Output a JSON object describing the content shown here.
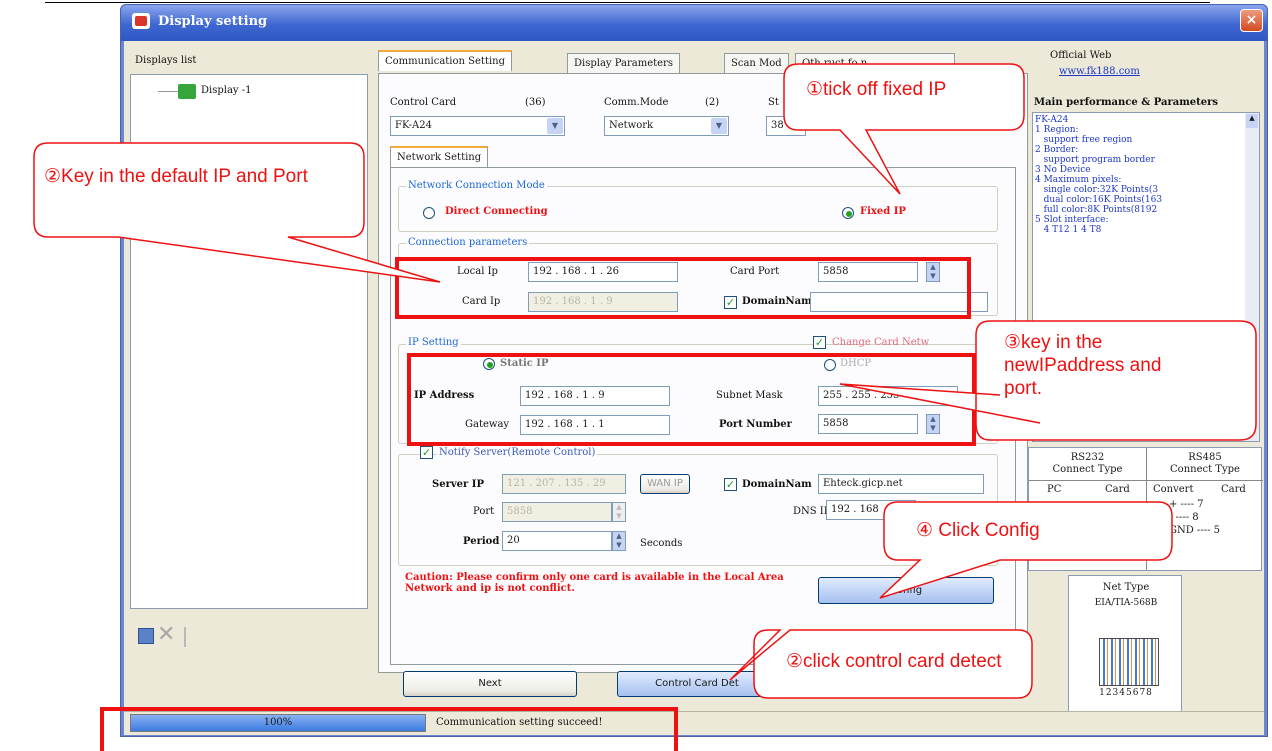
{
  "window": {
    "title": "Display setting",
    "close": "×"
  },
  "displays": {
    "heading": "Displays list",
    "item": "Display -1"
  },
  "tabs": [
    "Communication Setting",
    "Display Parameters",
    "Scan Mod",
    "Oth  ruct  fo n"
  ],
  "control": {
    "card_label": "Control Card",
    "card_count": "(36)",
    "card_value": "FK-A24",
    "comm_label": "Comm.Mode",
    "comm_count": "(2)",
    "comm_value": "Network",
    "third_label": "St",
    "third_value": "38"
  },
  "subtab": "Network Setting",
  "network_mode": {
    "legend": "Network Connection Mode",
    "direct": "Direct Connecting",
    "fixed": "Fixed IP"
  },
  "conn_params": {
    "legend": "Connection parameters",
    "local_ip_label": "Local Ip",
    "local_ip": [
      "192",
      "168",
      "1",
      "26"
    ],
    "card_ip_label": "Card Ip",
    "card_ip": [
      "192",
      "168",
      "1",
      "9"
    ],
    "card_port_label": "Card Port",
    "card_port": "5858",
    "domain_label": "DomainNam"
  },
  "ip_setting": {
    "legend": "IP Setting",
    "change_label": "Change Card Netw",
    "static": "Static IP",
    "dhcp": "DHCP",
    "ip_label": "IP Address",
    "ip": [
      "192",
      "168",
      "1",
      "9"
    ],
    "gateway_label": "Gateway",
    "gateway": [
      "192",
      "168",
      "1",
      "1"
    ],
    "subnet_label": "Subnet Mask",
    "subnet": "255 . 255 . 255",
    "port_label": "Port Number",
    "port": "5858"
  },
  "notify": {
    "label": "Notify Server(Remote Control)",
    "server_ip_label": "Server IP",
    "server_ip": "121 . 207 . 135 . 29",
    "wan_btn": "WAN IP",
    "domain_label": "DomainNam",
    "domain": "Ehteck.gicp.net",
    "port_label": "Port",
    "port": "5858",
    "dns_label": "DNS IP",
    "dns": "192 . 168",
    "period_label": "Period",
    "period": "20",
    "seconds": "Seconds"
  },
  "caution": "Caution: Please confirm only one card is available in the Local Area Network and ip is not conflict.",
  "buttons": {
    "config": "Config",
    "next": "Next",
    "detect": "Control Card Det"
  },
  "official": {
    "label": "Official Web",
    "url": "www.fk188.com"
  },
  "main_perf": {
    "heading": "Main performance & Parameters",
    "lines": [
      "FK-A24",
      "1 Region:",
      "   support free region",
      "2 Border:",
      "   support program border",
      "3 No Device",
      "4 Maximum pixels:",
      "   single color:32K Points(3",
      "   dual color:16K Points(163",
      "   full color:8K Points(8192",
      "5 Slot interface:",
      "   4 T12 1 4 T8"
    ]
  },
  "rs232": {
    "title": "RS232\nConnect Type",
    "col1": "PC",
    "col2": "Card"
  },
  "rs485": {
    "title": "RS485\nConnect Type",
    "col1": "Convert",
    "col2": "Card",
    "rows": [
      "+ ---- 7",
      "- ---- 8",
      "GND ---- 5"
    ]
  },
  "net_type": {
    "title": "Net Type",
    "sub": "EIA/TIA-568B",
    "pins": "12345678"
  },
  "status": {
    "progress_label": "100%",
    "progress": 1.0,
    "message": "Communication setting succeed!"
  },
  "callouts": {
    "c1": "①tick off fixed IP",
    "c2a": "②Key in the default IP and Port",
    "c3": "③key in the newIPaddress and port.",
    "c4": "④ Click Config",
    "c2b": "②click control card detect"
  }
}
